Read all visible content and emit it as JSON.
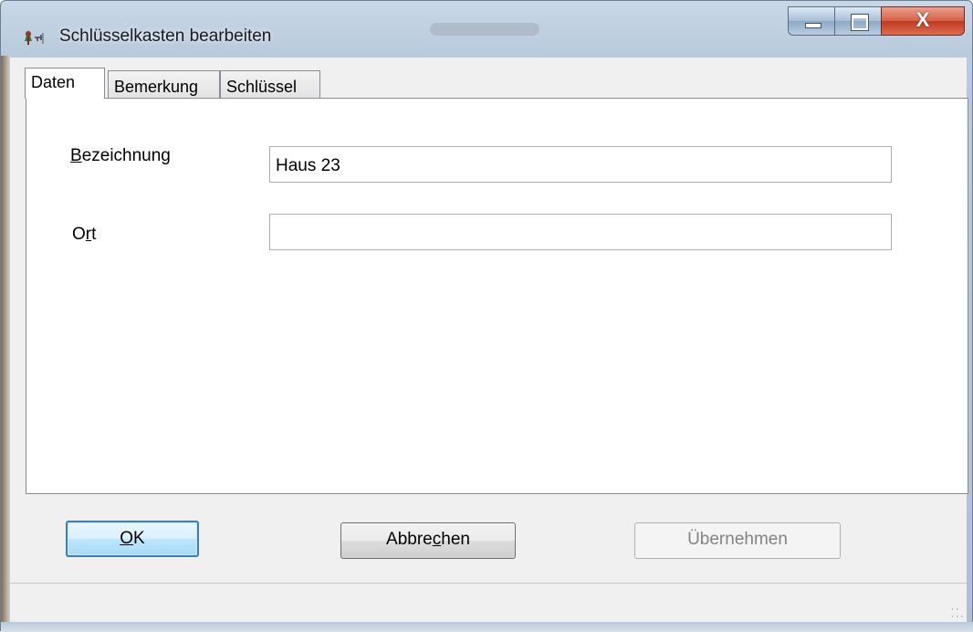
{
  "window": {
    "title": "Schlüsselkasten bearbeiten",
    "controls": {
      "minimize": "minimize-icon",
      "maximize": "maximize-icon",
      "close": "close-icon",
      "close_glyph": "X"
    }
  },
  "tabs": [
    {
      "label": "Daten",
      "active": true
    },
    {
      "label": "Bemerkung",
      "active": false
    },
    {
      "label": "Schlüssel",
      "active": false
    }
  ],
  "form": {
    "bezeichnung": {
      "label_first": "B",
      "label_rest": "ezeichnung",
      "value": "Haus 23"
    },
    "ort": {
      "label_first": "O",
      "label_mid": "r",
      "label_rest": "t",
      "value": ""
    }
  },
  "buttons": {
    "ok": {
      "label_mnemonic": "O",
      "label_rest": "K"
    },
    "cancel": {
      "label_pre": "Abbre",
      "label_mnemonic": "c",
      "label_rest": "hen"
    },
    "apply": {
      "label": "Übernehmen",
      "enabled": false
    }
  }
}
